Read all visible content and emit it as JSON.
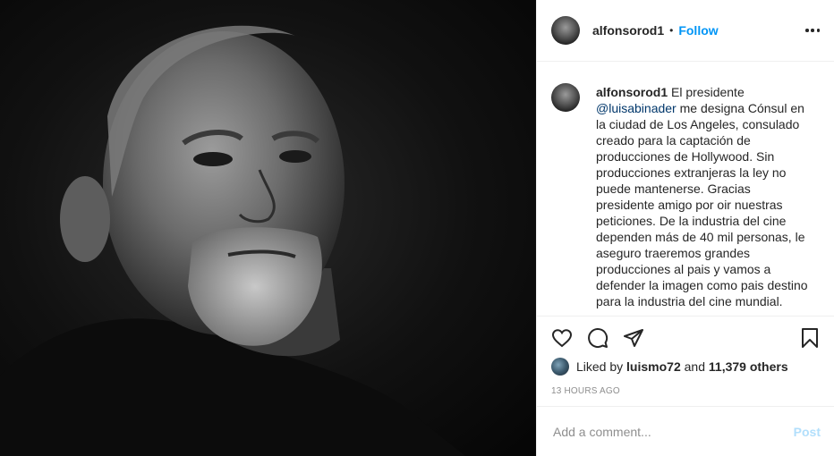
{
  "post": {
    "username": "alfonsorod1",
    "separator": "•",
    "follow_label": "Follow",
    "caption_prefix": "El presidente",
    "caption_mention": "@luisabinader",
    "caption_rest": "me designa Cónsul en la ciudad de Los Angeles, consulado creado para la captación de producciones de Hollywood. Sin producciones extranjeras la ley no puede mantenerse. Gracias presidente amigo por oir nuestras peticiones. De la industria del cine dependen más de 40 mil personas, le aseguro traeremos grandes producciones al pais y vamos a defender la imagen como pais destino para la industria del cine mundial.",
    "likes_prefix": "Liked by",
    "liked_by_user": "luismo72",
    "likes_and": "and",
    "likes_others": "11,379 others",
    "timestamp": "13 HOURS AGO"
  },
  "comment": {
    "placeholder": "Add a comment...",
    "post_label": "Post"
  },
  "icons": {
    "more": "more-options-icon",
    "like": "heart-icon",
    "comment": "comment-icon",
    "share": "paper-plane-icon",
    "save": "bookmark-icon"
  },
  "colors": {
    "link": "#0095f6",
    "mention": "#00376b",
    "text": "#262626",
    "muted": "#8e8e8e",
    "post_disabled": "#b2dffc"
  }
}
